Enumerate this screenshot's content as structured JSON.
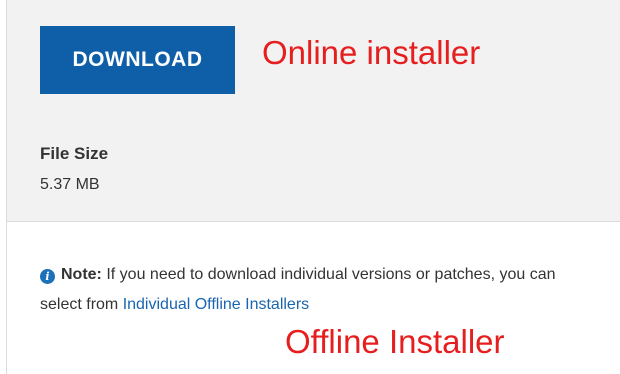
{
  "download": {
    "button_label": "DOWNLOAD"
  },
  "annotations": {
    "online": "Online installer",
    "offline": "Offline Installer"
  },
  "file_size": {
    "label": "File Size",
    "value": "5.37 MB"
  },
  "note": {
    "icon": "info-icon",
    "label": "Note:",
    "text_before_link": " If you need to download individual versions or patches, you can select from ",
    "link_text": "Individual Offline Installers"
  },
  "colors": {
    "button_bg": "#0f5fa8",
    "annotation": "#e61e1e",
    "link": "#1a65b0",
    "panel_bg": "#f2f2f2"
  }
}
